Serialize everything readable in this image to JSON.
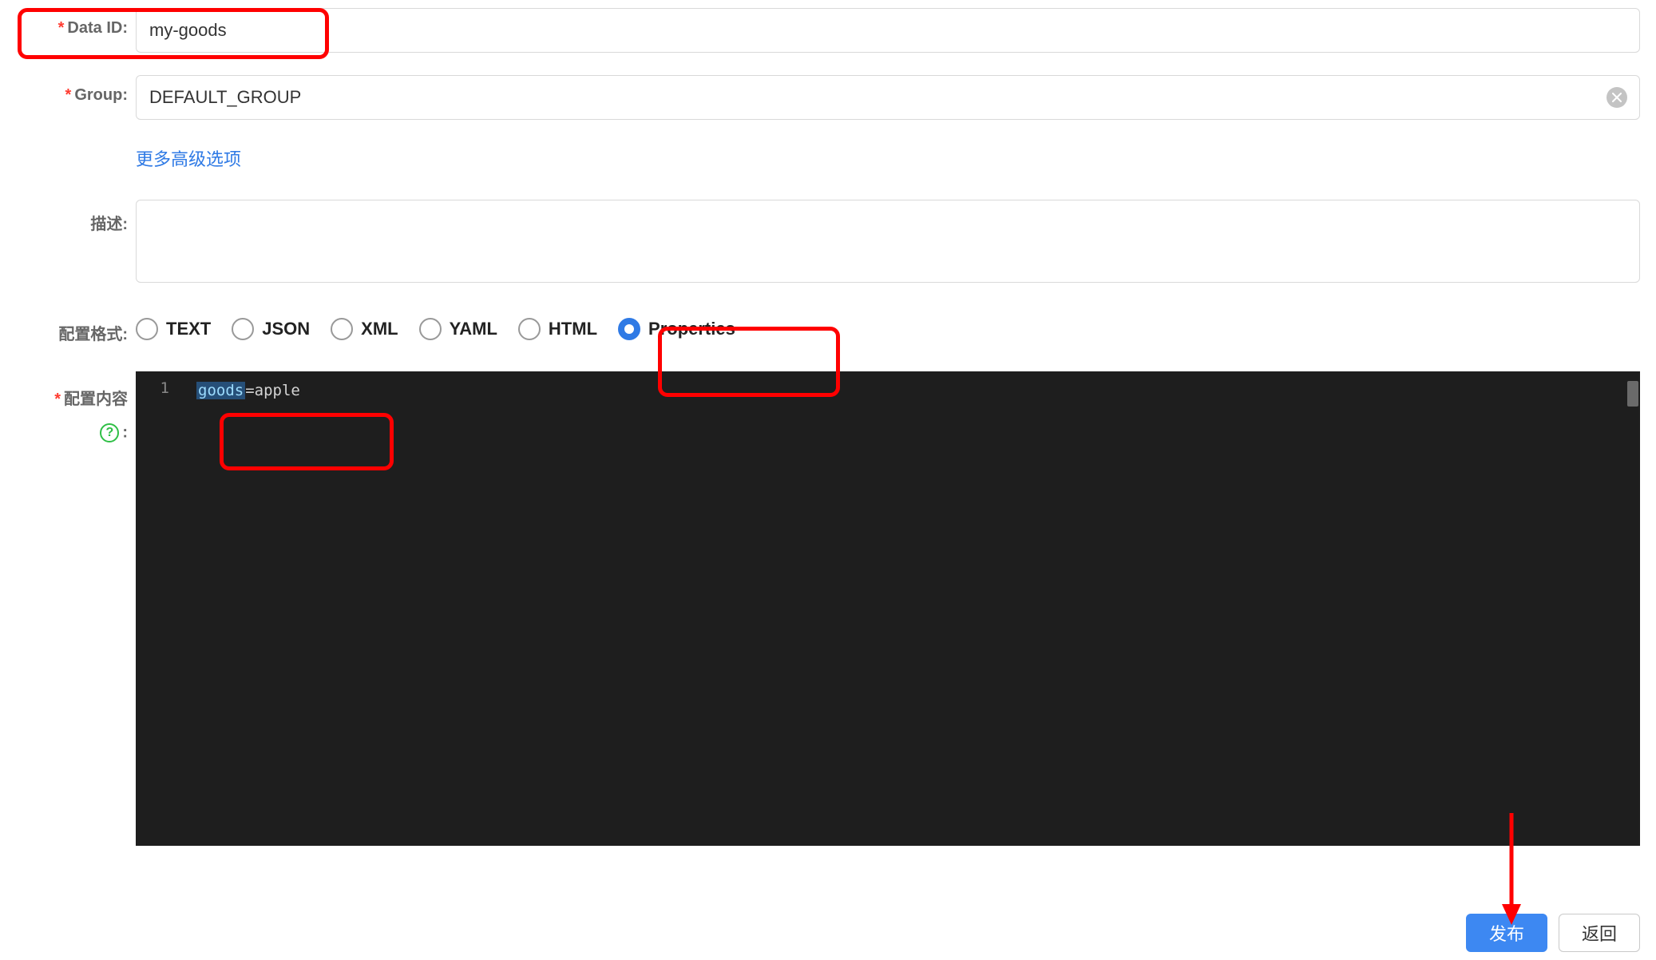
{
  "fields": {
    "dataId": {
      "label": "Data ID:",
      "value": "my-goods"
    },
    "group": {
      "label": "Group:",
      "value": "DEFAULT_GROUP"
    },
    "desc": {
      "label": "描述:",
      "value": ""
    },
    "format": {
      "label": "配置格式:"
    },
    "content": {
      "label": "配置内容"
    }
  },
  "moreOptions": "更多高级选项",
  "formats": {
    "options": [
      {
        "key": "text",
        "label": "TEXT"
      },
      {
        "key": "json",
        "label": "JSON"
      },
      {
        "key": "xml",
        "label": "XML"
      },
      {
        "key": "yaml",
        "label": "YAML"
      },
      {
        "key": "html",
        "label": "HTML"
      },
      {
        "key": "properties",
        "label": "Properties"
      }
    ],
    "selected": "properties"
  },
  "editor": {
    "lineNo": "1",
    "code": {
      "key": "goods",
      "op": "=",
      "val": "apple"
    }
  },
  "buttons": {
    "publish": "发布",
    "back": "返回"
  }
}
